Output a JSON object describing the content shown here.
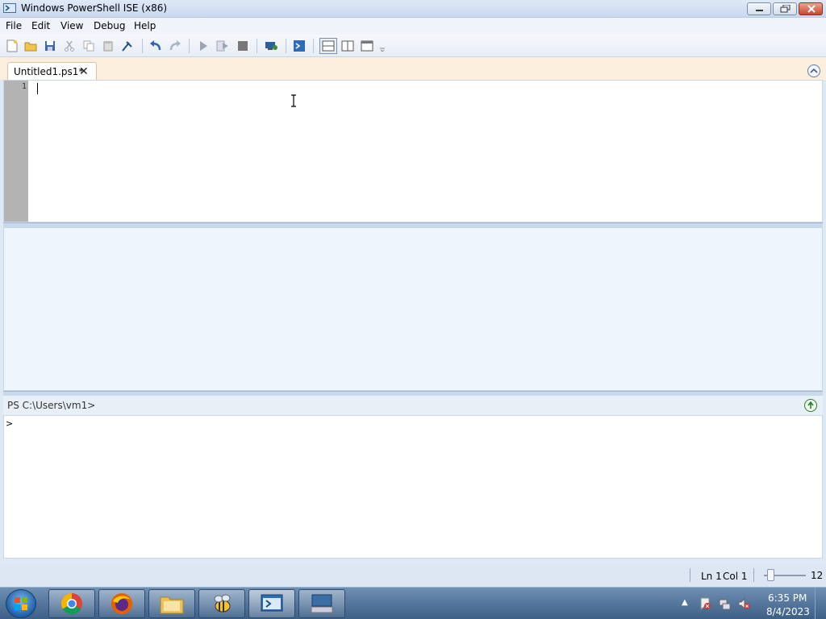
{
  "window": {
    "title": "Windows PowerShell ISE (x86)",
    "icon": "powershell-ise-icon"
  },
  "menu": {
    "items": [
      "File",
      "Edit",
      "View",
      "Debug",
      "Help"
    ]
  },
  "toolbar": {
    "buttons": [
      "new-icon",
      "open-icon",
      "save-icon",
      "cut-icon",
      "copy-icon",
      "paste-icon",
      "clear-icon",
      "undo-icon",
      "redo-icon",
      "run-icon",
      "run-selection-icon",
      "stop-icon",
      "remote-powershell-icon",
      "powershell-icon",
      "layout-top-icon",
      "layout-right-icon",
      "layout-max-icon"
    ]
  },
  "tabs": [
    {
      "label": "Untitled1.ps1*",
      "active": true
    }
  ],
  "editor": {
    "line_numbers": [
      "1"
    ],
    "content": ""
  },
  "command_pane": {
    "prompt": "PS C:\\Users\\vm1>",
    "input_prefix": ">"
  },
  "status": {
    "line": "Ln 1",
    "column": "Col 1",
    "zoom": "12"
  },
  "taskbar": {
    "apps": [
      "chrome-icon",
      "firefox-icon",
      "file-explorer-icon",
      "bee-app-icon",
      "powershell-icon",
      "keyboard-app-icon"
    ],
    "time": "6:35 PM",
    "date": "8/4/2023"
  },
  "colors": {
    "editor_gutter": "#b3b3b3",
    "output_background": "#eef5fd",
    "tab_strip": "#fbeedd",
    "taskbar": "#4d6f96"
  }
}
